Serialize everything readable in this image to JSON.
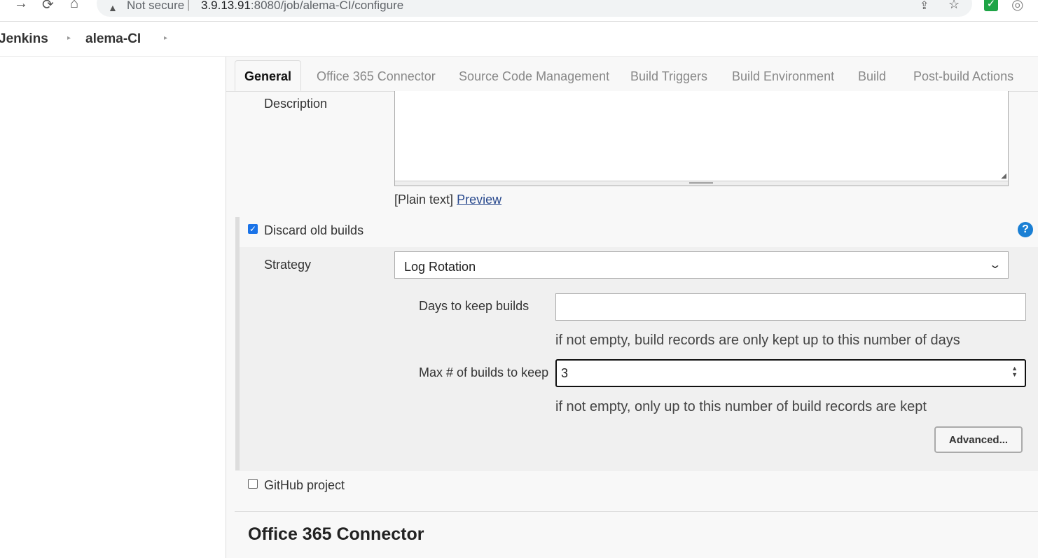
{
  "browser": {
    "security_label": "Not secure",
    "separator": "|",
    "url_host": "3.9.13.91",
    "url_path": ":8080/job/alema-CI/configure"
  },
  "breadcrumb": {
    "items": [
      {
        "label": "Jenkins"
      },
      {
        "label": "alema-CI"
      }
    ]
  },
  "tabs": [
    {
      "label": "General",
      "active": true
    },
    {
      "label": "Office 365 Connector"
    },
    {
      "label": "Source Code Management"
    },
    {
      "label": "Build Triggers"
    },
    {
      "label": "Build Environment"
    },
    {
      "label": "Build"
    },
    {
      "label": "Post-build Actions"
    }
  ],
  "general": {
    "description_label": "Description",
    "description_value": "",
    "plain_text_label": "[Plain text]",
    "preview_link": "Preview",
    "discard_old_builds": {
      "label": "Discard old builds",
      "checked": true,
      "help": "?",
      "strategy_label": "Strategy",
      "strategy_value": "Log Rotation",
      "days_label": "Days to keep builds",
      "days_value": "",
      "days_hint": "if not empty, build records are only kept up to this number of days",
      "max_label": "Max # of builds to keep",
      "max_value": "3",
      "max_hint": "if not empty, only up to this number of build records are kept",
      "advanced_button": "Advanced..."
    },
    "github_project": {
      "label": "GitHub project",
      "checked": false
    }
  },
  "next_section_title": "Office 365 Connector"
}
